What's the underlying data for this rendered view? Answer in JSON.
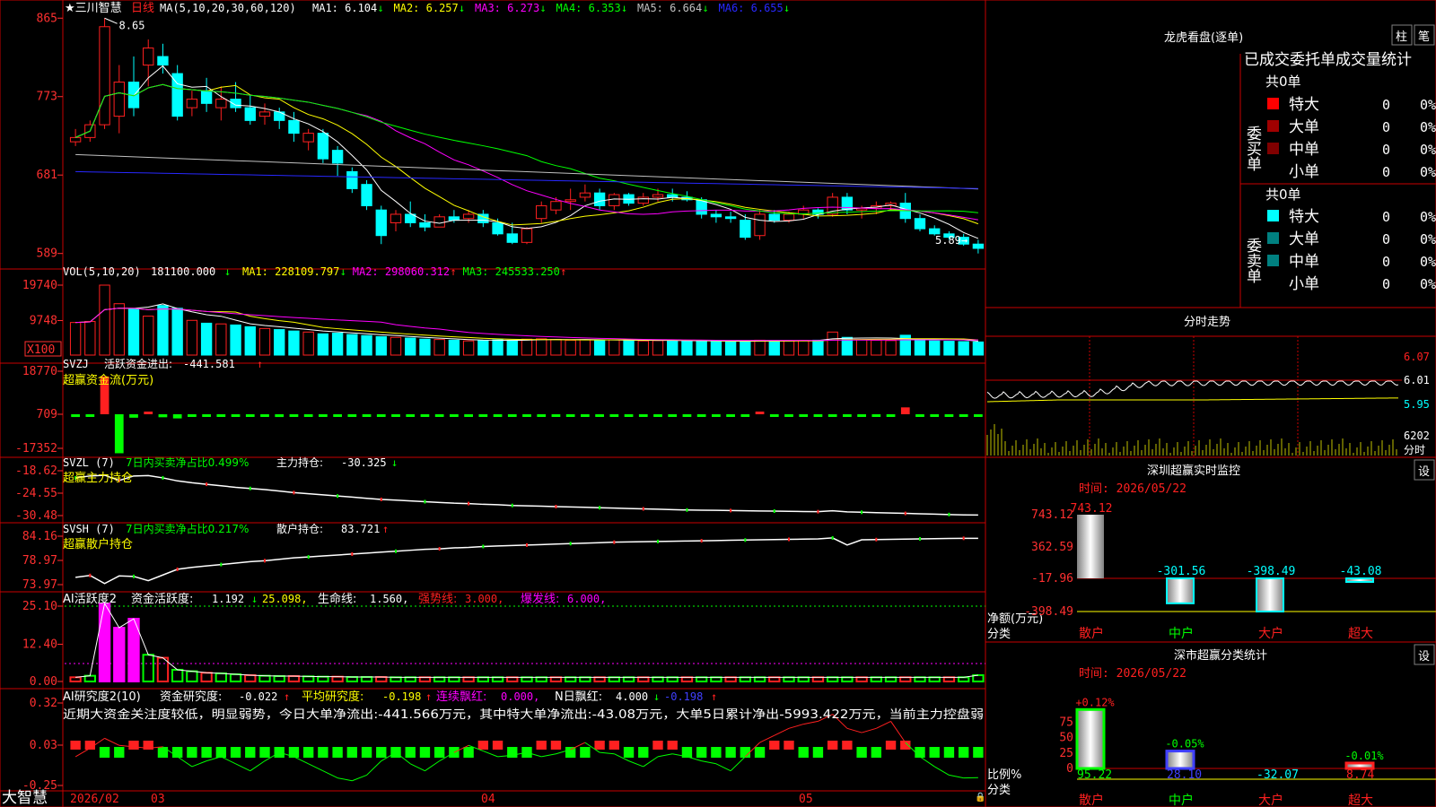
{
  "app": {
    "brand": "大智慧"
  },
  "colors": {
    "frame": "#c80000",
    "up": "#ff2020",
    "down": "#00ffff",
    "green": "#00ff00",
    "yellow": "#ffff00",
    "magenta": "#ff00ff",
    "white": "#ffffff",
    "blue": "#4040ff",
    "gray": "#c0c0c0",
    "label": "#ff3030",
    "cyan": "#00ffff"
  },
  "main_chart": {
    "stock_name": "★三川智慧",
    "period": "日线",
    "ma_header": "MA(5,10,20,30,60,120)",
    "ma_values": [
      {
        "name": "MA1:",
        "value": "6.104",
        "arrow": "↓",
        "color": "#ffffff"
      },
      {
        "name": "MA2:",
        "value": "6.257",
        "arrow": "↓",
        "color": "#ffff00"
      },
      {
        "name": "MA3:",
        "value": "6.273",
        "arrow": "↓",
        "color": "#ff00ff"
      },
      {
        "name": "MA4:",
        "value": "6.353",
        "arrow": "↓",
        "color": "#00ff00"
      },
      {
        "name": "MA5:",
        "value": "6.664",
        "arrow": "↓",
        "color": "#c0c0c0"
      },
      {
        "name": "MA6:",
        "value": "6.655",
        "arrow": "↓",
        "color": "#2828ff"
      }
    ],
    "y_ticks": [
      "865",
      "773",
      "681",
      "589"
    ],
    "high_label": "8.65",
    "low_label": "5.89→"
  },
  "volume_panel": {
    "header": "VOL(5,10,20)",
    "value": "181100.000",
    "arrow": "↓",
    "ma_values": [
      {
        "name": "MA1:",
        "value": "228109.797",
        "arrow": "↓",
        "color": "#ffff00"
      },
      {
        "name": "MA2:",
        "value": "298060.312",
        "arrow": "↑",
        "color": "#ff00ff"
      },
      {
        "name": "MA3:",
        "value": "245533.250",
        "arrow": "↑",
        "color": "#00ff00"
      }
    ],
    "y_ticks": [
      "19740",
      "9748"
    ],
    "unit": "X100"
  },
  "svzj_panel": {
    "name": "SVZJ",
    "label": "活跃资金进出:",
    "value": "-441.581",
    "arrow": "↑",
    "subtitle": "超赢资金流(万元)",
    "y_ticks": [
      "18770",
      "709",
      "-17352"
    ]
  },
  "svzl_panel": {
    "name": "SVZL (7)",
    "stat": "7日内买卖净占比0.499%",
    "label": "主力持仓:",
    "value": "-30.325",
    "arrow": "↓",
    "subtitle": "超赢主力持仓",
    "y_ticks": [
      "-18.62",
      "-24.55",
      "-30.48"
    ]
  },
  "svsh_panel": {
    "name": "SVSH (7)",
    "stat": "7日内买卖净占比0.217%",
    "label": "散户持仓:",
    "value": "83.721",
    "arrow": "↑",
    "subtitle": "超赢散户持仓",
    "y_ticks": [
      "84.16",
      "78.97",
      "73.97"
    ]
  },
  "ai_activity_panel": {
    "name": "AI活跃度2",
    "label": "资金活跃度:",
    "value": "1.192",
    "arrow": "↓",
    "value2": "25.098,",
    "life_label": "生命线:",
    "life_value": "1.560,",
    "strong_label": "强势线:",
    "strong_value": "3.000,",
    "burst_label": "爆发线:",
    "burst_value": "6.000,",
    "y_ticks": [
      "25.10",
      "12.40",
      "0.00"
    ]
  },
  "ai_research_panel": {
    "name": "AI研究度2(10)",
    "label": "资金研究度:",
    "value": "-0.022",
    "arrow": "↑",
    "avg_label": "平均研究度:",
    "avg_value": "-0.198",
    "avg_arrow": "↑",
    "red_label": "连续飘红:",
    "red_value": "0.000,",
    "nred_label": "N日飘红:",
    "nred_value": "4.000",
    "nred_arrow": "↓",
    "last_value": "-0.198",
    "last_arrow": "↑",
    "commentary": "近期大资金关注度较低，明显弱势，今日大单净流出:-441.566万元，其中特大单净流出:-43.08万元，大单5日累计净出-5993.422万元，当前主力控盘弱",
    "y_ticks": [
      "0.32",
      "0.03",
      "-0.25"
    ]
  },
  "x_axis": {
    "labels": [
      "2026/02",
      "03",
      "04",
      "05"
    ]
  },
  "dragon_tiger": {
    "title": "龙虎看盘(逐单)",
    "btn_col": "柱",
    "btn_tick": "笔",
    "subtitle": "已成交委托单成交量统计",
    "buy_label": "委买单",
    "sell_label": "委卖单",
    "buy_total": "共0单",
    "sell_total": "共0单",
    "buy_rows": [
      {
        "label": "特大",
        "count": "0",
        "pct": "0%",
        "color": "#ff0000"
      },
      {
        "label": "大单",
        "count": "0",
        "pct": "0%",
        "color": "#a00000"
      },
      {
        "label": "中单",
        "count": "0",
        "pct": "0%",
        "color": "#800000"
      },
      {
        "label": "小单",
        "count": "0",
        "pct": "0%",
        "color": ""
      }
    ],
    "sell_rows": [
      {
        "label": "特大",
        "count": "0",
        "pct": "0%",
        "color": "#00ffff"
      },
      {
        "label": "大单",
        "count": "0",
        "pct": "0%",
        "color": "#008080"
      },
      {
        "label": "中单",
        "count": "0",
        "pct": "0%",
        "color": "#008080"
      },
      {
        "label": "小单",
        "count": "0",
        "pct": "0%",
        "color": ""
      }
    ]
  },
  "intraday": {
    "title": "分时走势",
    "y_ticks": [
      "6.07",
      "6.01",
      "5.95"
    ],
    "volume_label": "6202",
    "unit": "分时"
  },
  "monitor": {
    "title": "深圳超赢实时监控",
    "settings": "设",
    "date": "时间: 2026/05/22",
    "y_ticks": [
      "743.12",
      "362.59",
      "-17.96",
      "-398.49"
    ],
    "axis_label": "净额(万元)",
    "cat_label": "分类"
  },
  "classify": {
    "title": "深市超赢分类统计",
    "settings": "设",
    "date": "时间: 2026/05/22",
    "y_ticks": [
      "75",
      "50",
      "25",
      "0"
    ],
    "axis_label": "比例%",
    "cat_label": "分类"
  },
  "chart_data": [
    {
      "type": "candlestick",
      "title": "三川智慧 日线",
      "y_ticks": [
        5.89,
        6.81,
        7.73,
        8.65
      ],
      "ohlc": [
        [
          7.2,
          7.35,
          7.15,
          7.25
        ],
        [
          7.25,
          7.45,
          7.2,
          7.4
        ],
        [
          7.4,
          8.65,
          7.35,
          8.55
        ],
        [
          7.5,
          8.1,
          7.3,
          7.9
        ],
        [
          7.9,
          8.2,
          7.5,
          7.6
        ],
        [
          8.1,
          8.4,
          7.85,
          8.3
        ],
        [
          8.2,
          8.35,
          8.0,
          8.1
        ],
        [
          8.0,
          8.1,
          7.45,
          7.5
        ],
        [
          7.6,
          7.8,
          7.5,
          7.7
        ],
        [
          7.8,
          7.95,
          7.55,
          7.65
        ],
        [
          7.6,
          7.85,
          7.45,
          7.7
        ],
        [
          7.7,
          7.9,
          7.55,
          7.6
        ],
        [
          7.6,
          7.75,
          7.4,
          7.45
        ],
        [
          7.5,
          7.65,
          7.4,
          7.55
        ],
        [
          7.55,
          7.6,
          7.35,
          7.45
        ],
        [
          7.45,
          7.55,
          7.2,
          7.3
        ],
        [
          7.2,
          7.35,
          7.1,
          7.3
        ],
        [
          7.3,
          7.35,
          6.95,
          7.0
        ],
        [
          7.1,
          7.15,
          6.8,
          6.95
        ],
        [
          6.85,
          6.9,
          6.6,
          6.65
        ],
        [
          6.7,
          6.75,
          6.4,
          6.45
        ],
        [
          6.4,
          6.45,
          6.0,
          6.1
        ],
        [
          6.25,
          6.4,
          6.15,
          6.35
        ],
        [
          6.35,
          6.5,
          6.2,
          6.25
        ],
        [
          6.25,
          6.35,
          6.15,
          6.2
        ],
        [
          6.2,
          6.35,
          6.2,
          6.32
        ],
        [
          6.32,
          6.4,
          6.25,
          6.28
        ],
        [
          6.3,
          6.4,
          6.25,
          6.35
        ],
        [
          6.35,
          6.4,
          6.2,
          6.25
        ],
        [
          6.25,
          6.3,
          6.1,
          6.12
        ],
        [
          6.12,
          6.25,
          6.0,
          6.02
        ],
        [
          6.02,
          6.2,
          6.0,
          6.18
        ],
        [
          6.3,
          6.5,
          6.25,
          6.45
        ],
        [
          6.4,
          6.55,
          6.35,
          6.5
        ],
        [
          6.5,
          6.65,
          6.4,
          6.52
        ],
        [
          6.55,
          6.7,
          6.5,
          6.6
        ],
        [
          6.6,
          6.65,
          6.4,
          6.45
        ],
        [
          6.45,
          6.6,
          6.4,
          6.58
        ],
        [
          6.58,
          6.6,
          6.45,
          6.48
        ],
        [
          6.48,
          6.6,
          6.45,
          6.55
        ],
        [
          6.55,
          6.65,
          6.5,
          6.58
        ],
        [
          6.58,
          6.65,
          6.5,
          6.55
        ],
        [
          6.55,
          6.62,
          6.5,
          6.52
        ],
        [
          6.52,
          6.55,
          6.3,
          6.35
        ],
        [
          6.35,
          6.4,
          6.25,
          6.32
        ],
        [
          6.32,
          6.38,
          6.25,
          6.3
        ],
        [
          6.28,
          6.35,
          6.05,
          6.08
        ],
        [
          6.1,
          6.4,
          6.05,
          6.35
        ],
        [
          6.35,
          6.4,
          6.25,
          6.28
        ],
        [
          6.28,
          6.38,
          6.25,
          6.35
        ],
        [
          6.35,
          6.45,
          6.3,
          6.4
        ],
        [
          6.4,
          6.42,
          6.3,
          6.35
        ],
        [
          6.35,
          6.6,
          6.32,
          6.55
        ],
        [
          6.55,
          6.6,
          6.35,
          6.4
        ],
        [
          6.4,
          6.45,
          6.3,
          6.42
        ],
        [
          6.42,
          6.5,
          6.35,
          6.45
        ],
        [
          6.45,
          6.5,
          6.4,
          6.48
        ],
        [
          6.48,
          6.6,
          6.25,
          6.3
        ],
        [
          6.3,
          6.35,
          6.15,
          6.18
        ],
        [
          6.18,
          6.22,
          6.1,
          6.12
        ],
        [
          6.12,
          6.15,
          6.05,
          6.08
        ],
        [
          6.08,
          6.12,
          5.98,
          6.0
        ],
        [
          6.0,
          6.05,
          5.89,
          5.95
        ]
      ]
    },
    {
      "type": "bar",
      "title": "VOL(5,10,20)",
      "values": [
        9200,
        9500,
        19740,
        14500,
        13000,
        11000,
        14000,
        13200,
        9800,
        9000,
        8800,
        8500,
        8000,
        7500,
        7200,
        6800,
        6500,
        6000,
        6200,
        5800,
        5500,
        5200,
        5000,
        4800,
        4500,
        4400,
        4200,
        4000,
        4100,
        4300,
        4200,
        4500,
        4600,
        4400,
        4200,
        4300,
        4200,
        4300,
        4100,
        4000,
        4100,
        4200,
        4000,
        3900,
        3800,
        3700,
        4000,
        4200,
        4100,
        4000,
        4100,
        4200,
        6500,
        5000,
        4300,
        4200,
        4100,
        5600,
        4200,
        4000,
        3900,
        3800,
        3700
      ]
    },
    {
      "type": "bar",
      "title": "超赢资金流(万元)",
      "ylim": [
        -17352,
        18770
      ],
      "values": [
        -1200,
        -300,
        16500,
        -17000,
        -1500,
        900,
        -1300,
        -1800,
        -900,
        -300,
        -600,
        -1000,
        -700,
        -400,
        -1200,
        -500,
        -600,
        -400,
        -300,
        -800,
        -500,
        -600,
        -300,
        -500,
        -600,
        -700,
        -400,
        -500,
        -600,
        -500,
        -400,
        -400,
        -500,
        -600,
        -500,
        -700,
        -600,
        -800,
        -900,
        -500,
        -600,
        -500,
        -400,
        -600,
        -800,
        -700,
        -900,
        1000,
        -700,
        -500,
        -600,
        -500,
        -600,
        -400,
        -500,
        -700,
        -600,
        3000,
        -800,
        -500,
        -600,
        -500,
        -441
      ]
    },
    {
      "type": "line",
      "title": "主力持仓",
      "ylim": [
        -30.48,
        -18.62
      ],
      "values": [
        -20.5,
        -20.0,
        -19.8,
        -21.2,
        -20.0,
        -19.9,
        -20.5,
        -21.3,
        -21.8,
        -22.2,
        -22.6,
        -23.0,
        -23.3,
        -23.6,
        -24.0,
        -24.4,
        -24.7,
        -25.0,
        -25.3,
        -25.6,
        -25.9,
        -26.2,
        -26.4,
        -26.6,
        -26.8,
        -27.0,
        -27.2,
        -27.3,
        -27.5,
        -27.6,
        -27.8,
        -27.9,
        -28.0,
        -28.1,
        -28.2,
        -28.3,
        -28.4,
        -28.5,
        -28.6,
        -28.7,
        -28.8,
        -28.9,
        -29.0,
        -29.05,
        -29.1,
        -29.15,
        -29.2,
        -29.25,
        -29.3,
        -29.35,
        -29.4,
        -29.45,
        -29.2,
        -29.5,
        -29.6,
        -29.7,
        -29.8,
        -29.9,
        -30.0,
        -30.1,
        -30.2,
        -30.3,
        -30.325
      ]
    },
    {
      "type": "line",
      "title": "散户持仓",
      "ylim": [
        73.97,
        84.16
      ],
      "values": [
        75.5,
        75.9,
        74.2,
        75.8,
        75.7,
        74.8,
        76.0,
        77.2,
        77.6,
        77.9,
        78.2,
        78.5,
        78.8,
        79.0,
        79.3,
        79.6,
        79.8,
        80.0,
        80.2,
        80.4,
        80.6,
        80.8,
        81.0,
        81.2,
        81.4,
        81.5,
        81.7,
        81.8,
        82.0,
        82.1,
        82.2,
        82.3,
        82.4,
        82.5,
        82.6,
        82.7,
        82.8,
        82.9,
        82.95,
        83.0,
        83.05,
        83.1,
        83.15,
        83.2,
        83.25,
        83.3,
        83.35,
        83.4,
        83.45,
        83.5,
        83.55,
        83.6,
        83.8,
        82.3,
        83.4,
        83.45,
        83.5,
        83.55,
        83.6,
        83.65,
        83.7,
        83.72,
        83.721
      ]
    },
    {
      "type": "bar",
      "title": "AI活跃度2",
      "ylim": [
        0,
        25.1
      ],
      "values": [
        0.5,
        1.0,
        25.1,
        17.0,
        20.0,
        8.0,
        7.0,
        3.0,
        2.5,
        2.0,
        1.8,
        1.5,
        1.2,
        1.0,
        0.9,
        0.9,
        0.8,
        0.7,
        0.7,
        0.6,
        0.6,
        0.6,
        0.5,
        0.5,
        0.5,
        0.5,
        0.5,
        0.5,
        0.5,
        0.5,
        0.5,
        0.5,
        0.5,
        0.5,
        0.5,
        0.5,
        0.5,
        0.5,
        0.5,
        0.5,
        0.5,
        0.5,
        0.5,
        0.5,
        0.5,
        0.5,
        0.5,
        0.5,
        0.5,
        0.5,
        0.5,
        0.5,
        0.5,
        0.5,
        0.5,
        0.5,
        0.5,
        0.5,
        0.5,
        0.5,
        0.5,
        0.5,
        1.192
      ]
    },
    {
      "type": "line",
      "title": "AI研究度2(10)",
      "ylim": [
        -0.25,
        0.32
      ],
      "values": [
        -0.05,
        0.01,
        0.08,
        0.03,
        0.02,
        0.01,
        0.02,
        -0.05,
        -0.12,
        -0.08,
        -0.05,
        -0.1,
        -0.15,
        -0.08,
        -0.02,
        -0.05,
        -0.1,
        -0.15,
        -0.2,
        -0.22,
        -0.18,
        -0.08,
        -0.02,
        -0.1,
        -0.15,
        -0.08,
        -0.02,
        0.03,
        -0.01,
        -0.05,
        -0.04,
        -0.02,
        -0.05,
        -0.03,
        0.0,
        0.05,
        -0.02,
        -0.03,
        -0.08,
        -0.12,
        -0.05,
        -0.03,
        -0.05,
        -0.08,
        -0.1,
        -0.15,
        -0.05,
        0.05,
        0.1,
        0.15,
        0.18,
        0.2,
        0.25,
        0.15,
        0.12,
        0.15,
        0.2,
        0.05,
        -0.05,
        -0.12,
        -0.18,
        -0.2,
        -0.198
      ]
    },
    {
      "type": "bar",
      "title": "深圳超赢实时监控",
      "categories": [
        "散户",
        "中户",
        "大户",
        "超大"
      ],
      "values": [
        743.12,
        -301.56,
        -398.49,
        -43.08
      ],
      "ylim": [
        -398.49,
        743.12
      ]
    },
    {
      "type": "bar",
      "title": "深市超赢分类统计",
      "categories": [
        "散户",
        "中户",
        "大户",
        "超大"
      ],
      "values": [
        95.22,
        28.1,
        -32.07,
        8.74
      ],
      "changes": [
        "+0.12%",
        "-0.05%",
        "",
        "-0.01%"
      ]
    }
  ]
}
